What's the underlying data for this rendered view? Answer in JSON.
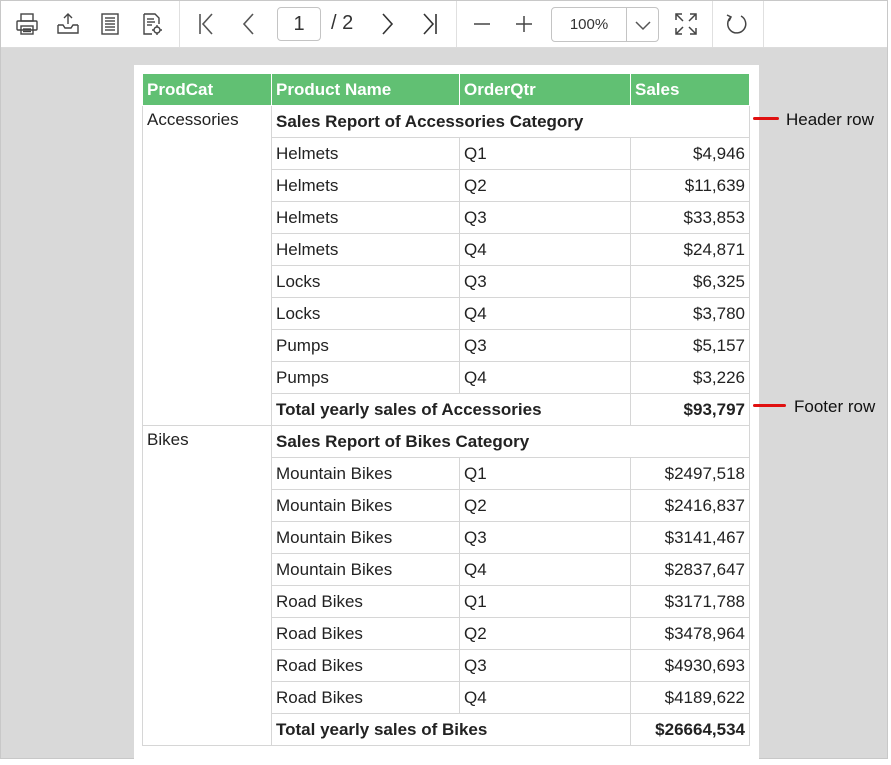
{
  "toolbar": {
    "icons": [
      "print-icon",
      "export-icon",
      "page-setup-icon",
      "page-view-icon",
      "first-page-icon",
      "previous-page-icon",
      "next-page-icon",
      "last-page-icon",
      "zoom-out-icon",
      "zoom-in-icon",
      "fit-page-icon",
      "refresh-icon"
    ],
    "current_page": "1",
    "total_pages": "/ 2",
    "zoom": "100%"
  },
  "report": {
    "columns": [
      "ProdCat",
      "Product Name",
      "OrderQtr",
      "Sales"
    ],
    "header_color": "#61c073",
    "groups": [
      {
        "category": "Accessories",
        "header": "Sales Report of Accessories Category",
        "rows": [
          [
            "Helmets",
            "Q1",
            "$4,946"
          ],
          [
            "Helmets",
            "Q2",
            "$11,639"
          ],
          [
            "Helmets",
            "Q3",
            "$33,853"
          ],
          [
            "Helmets",
            "Q4",
            "$24,871"
          ],
          [
            "Locks",
            "Q3",
            "$6,325"
          ],
          [
            "Locks",
            "Q4",
            "$3,780"
          ],
          [
            "Pumps",
            "Q3",
            "$5,157"
          ],
          [
            "Pumps",
            "Q4",
            "$3,226"
          ]
        ],
        "footer_label": "Total yearly sales of Accessories",
        "footer_value": "$93,797"
      },
      {
        "category": "Bikes",
        "header": "Sales Report of Bikes Category",
        "rows": [
          [
            "Mountain Bikes",
            "Q1",
            "$2497,518"
          ],
          [
            "Mountain Bikes",
            "Q2",
            "$2416,837"
          ],
          [
            "Mountain Bikes",
            "Q3",
            "$3141,467"
          ],
          [
            "Mountain Bikes",
            "Q4",
            "$2837,647"
          ],
          [
            "Road Bikes",
            "Q1",
            "$3171,788"
          ],
          [
            "Road Bikes",
            "Q2",
            "$3478,964"
          ],
          [
            "Road Bikes",
            "Q3",
            "$4930,693"
          ],
          [
            "Road Bikes",
            "Q4",
            "$4189,622"
          ]
        ],
        "footer_label": "Total yearly sales of Bikes",
        "footer_value": "$26664,534"
      }
    ]
  },
  "annotations": {
    "header_row": "Header row",
    "footer_row": "Footer row",
    "color": "#e01010"
  }
}
